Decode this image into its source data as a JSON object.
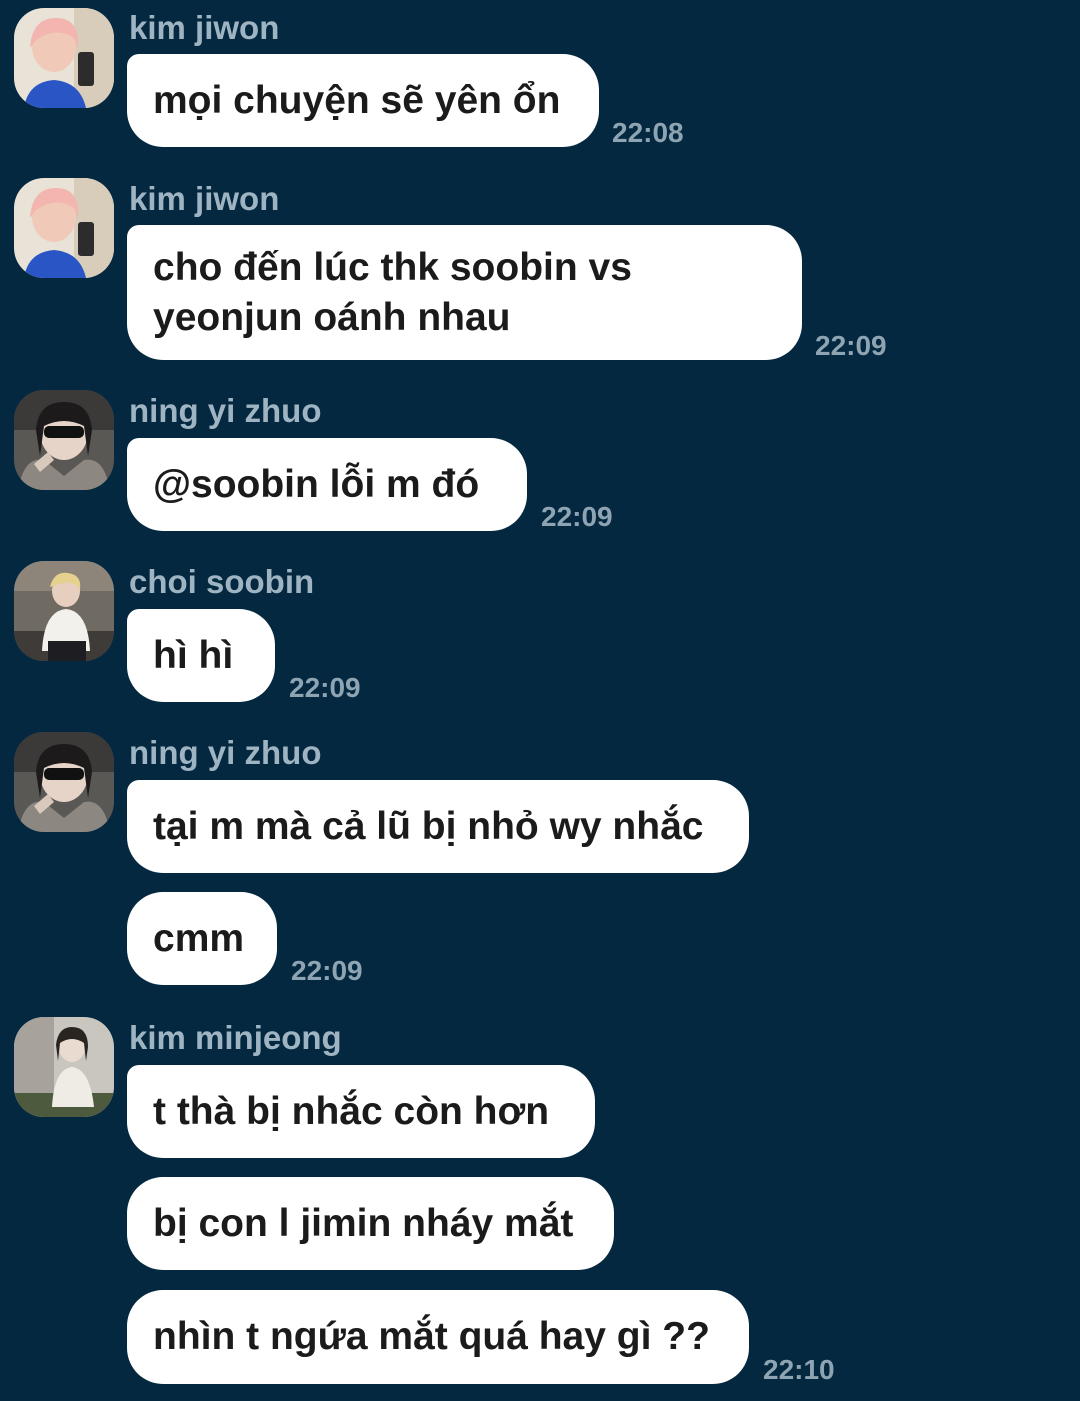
{
  "colors": {
    "background": "#04283f",
    "bubble": "#ffffff",
    "message_text": "#1b1b1b",
    "sender_name": "#9fb4c2",
    "timestamp": "#8ea4b3"
  },
  "messages": [
    {
      "sender": "kim jiwon",
      "avatar": "avatar-kim-jiwon",
      "lines": [
        "mọi chuyện sẽ yên ổn"
      ],
      "time": "22:08"
    },
    {
      "sender": "kim jiwon",
      "avatar": "avatar-kim-jiwon",
      "lines": [
        "cho đến lúc thk soobin vs yeonjun oánh nhau"
      ],
      "time": "22:09"
    },
    {
      "sender": "ning yi zhuo",
      "avatar": "avatar-ning-yi-zhuo",
      "lines": [
        "@soobin lỗi m đó"
      ],
      "time": "22:09"
    },
    {
      "sender": "choi soobin",
      "avatar": "avatar-choi-soobin",
      "lines": [
        "hì hì"
      ],
      "time": "22:09"
    },
    {
      "sender": "ning yi zhuo",
      "avatar": "avatar-ning-yi-zhuo",
      "lines": [
        "tại m mà cả lũ bị nhỏ wy nhắc",
        "cmm"
      ],
      "time": "22:09"
    },
    {
      "sender": "kim minjeong",
      "avatar": "avatar-kim-minjeong",
      "lines": [
        "t thà bị nhắc còn hơn",
        "bị con l jimin nháy mắt",
        "nhìn t ngứa mắt quá hay gì ??"
      ],
      "time": "22:10"
    }
  ]
}
